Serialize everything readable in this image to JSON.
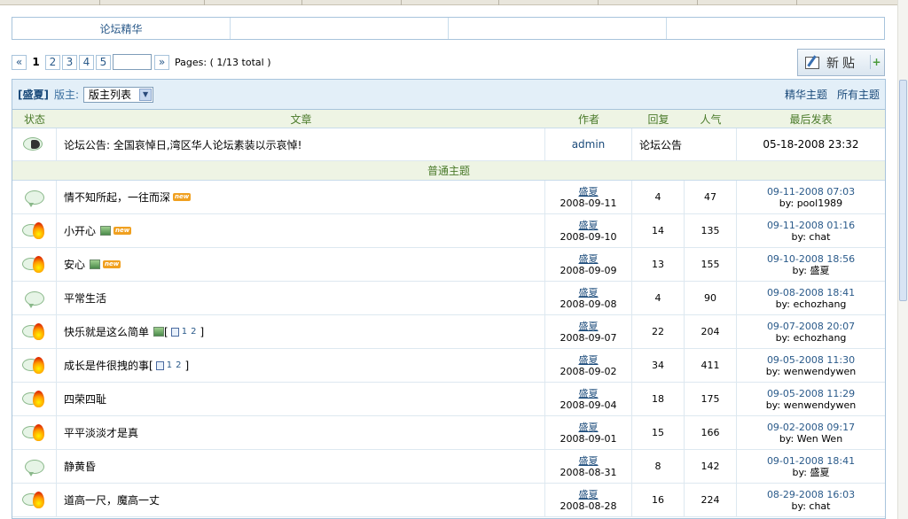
{
  "digest_table": {
    "cells": [
      "论坛精华",
      "",
      "",
      ""
    ]
  },
  "pager": {
    "first": "«",
    "pages": [
      "1",
      "2",
      "3",
      "4",
      "5"
    ],
    "next": "»",
    "info": "Pages: ( 1/13 total )"
  },
  "new_post": {
    "label": "新贴"
  },
  "forum": {
    "name": "[盛夏]",
    "moderator_label": "版主:",
    "moderator_select": "版主列表",
    "link_digest": "精华主题",
    "link_all": "所有主题",
    "columns": {
      "status": "状态",
      "title": "文章",
      "author": "作者",
      "replies": "回复",
      "views": "人气",
      "last": "最后发表"
    },
    "announcement": {
      "title": "论坛公告: 全国哀悼日,湾区华人论坛素装以示哀悼!",
      "author": "admin",
      "type": "论坛公告",
      "time": "05-18-2008 23:32"
    },
    "section_label": "普通主题",
    "topics": [
      {
        "title": "情不知所起，一往而深",
        "author": "盛夏",
        "date": "2008-09-11",
        "replies": "4",
        "views": "47",
        "last_time": "09-11-2008 07:03",
        "last_by": "by: pool1989",
        "icon": "normal",
        "img": false,
        "new": "new",
        "pages": []
      },
      {
        "title": "小开心",
        "author": "盛夏",
        "date": "2008-09-10",
        "replies": "14",
        "views": "135",
        "last_time": "09-11-2008 01:16",
        "last_by": "by: chat",
        "icon": "hot",
        "img": true,
        "new": "new",
        "pages": []
      },
      {
        "title": "安心",
        "author": "盛夏",
        "date": "2008-09-09",
        "replies": "13",
        "views": "155",
        "last_time": "09-10-2008 18:56",
        "last_by": "by: 盛夏",
        "icon": "hot",
        "img": true,
        "new": "new",
        "pages": []
      },
      {
        "title": "平常生活",
        "author": "盛夏",
        "date": "2008-09-08",
        "replies": "4",
        "views": "90",
        "last_time": "09-08-2008 18:41",
        "last_by": "by: echozhang",
        "icon": "normal",
        "img": false,
        "new": "",
        "pages": []
      },
      {
        "title": "快乐就是这么简单",
        "author": "盛夏",
        "date": "2008-09-07",
        "replies": "22",
        "views": "204",
        "last_time": "09-07-2008 20:07",
        "last_by": "by: echozhang",
        "icon": "hot",
        "img": true,
        "new": "",
        "pages": [
          "1",
          "2"
        ]
      },
      {
        "title": "成长是件很拽的事",
        "author": "盛夏",
        "date": "2008-09-02",
        "replies": "34",
        "views": "411",
        "last_time": "09-05-2008 11:30",
        "last_by": "by: wenwendywen",
        "icon": "hot",
        "img": false,
        "new": "",
        "pages": [
          "1",
          "2"
        ]
      },
      {
        "title": "四荣四耻",
        "author": "盛夏",
        "date": "2008-09-04",
        "replies": "18",
        "views": "175",
        "last_time": "09-05-2008 11:29",
        "last_by": "by: wenwendywen",
        "icon": "hot",
        "img": false,
        "new": "",
        "pages": []
      },
      {
        "title": "平平淡淡才是真",
        "author": "盛夏",
        "date": "2008-09-01",
        "replies": "15",
        "views": "166",
        "last_time": "09-02-2008 09:17",
        "last_by": "by: Wen Wen",
        "icon": "hot",
        "img": false,
        "new": "",
        "pages": []
      },
      {
        "title": "静黄昏",
        "author": "盛夏",
        "date": "2008-08-31",
        "replies": "8",
        "views": "142",
        "last_time": "09-01-2008 18:41",
        "last_by": "by: 盛夏",
        "icon": "normal",
        "img": false,
        "new": "",
        "pages": []
      },
      {
        "title": "道高一尺，魔高一丈",
        "author": "盛夏",
        "date": "2008-08-28",
        "replies": "16",
        "views": "224",
        "last_time": "08-29-2008 16:03",
        "last_by": "by: chat",
        "icon": "hot",
        "img": false,
        "new": "",
        "pages": []
      }
    ]
  }
}
